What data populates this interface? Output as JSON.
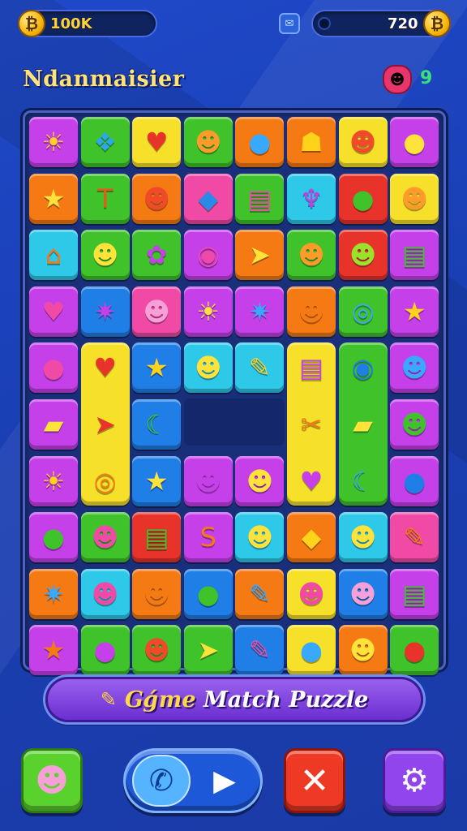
{
  "hud": {
    "coins": "100K",
    "coin_symbol": "₿",
    "score": "720",
    "badge_icon": "chat-badge-icon"
  },
  "player": {
    "name": "Ndanmaisier",
    "avatar_icon": "creature-avatar-icon",
    "level": "9"
  },
  "banner": {
    "first_word": "Gǵme",
    "rest": "Match Puzzle",
    "icon": "pencil-icon"
  },
  "buttons": {
    "face_icon": "pink-creature-icon",
    "call_icon": "phone-icon",
    "play_icon": "play-icon",
    "close_icon": "close-icon",
    "settings_icon": "gear-icon"
  },
  "board": {
    "colors": {
      "purple": "#c640ea",
      "green": "#3fc22a",
      "yellow": "#f7e02a",
      "orange": "#f57a14",
      "blue": "#1f7fe6",
      "cyan": "#2ec8e8",
      "pink": "#f04aa6",
      "red": "#e8332a",
      "lime": "#9be22c"
    },
    "rows": [
      [
        [
          "purple",
          "☀",
          "#ffd21c"
        ],
        [
          "green",
          "❖",
          "#2aa8e8"
        ],
        [
          "yellow",
          "♥",
          "#e8332a"
        ],
        [
          "green",
          "☻",
          "#ff9b2a"
        ],
        [
          "orange",
          "●",
          "#39a8ff"
        ],
        [
          "orange",
          "☗",
          "#ffd21c"
        ],
        [
          "yellow",
          "☻",
          "#f04a2a"
        ],
        [
          "purple",
          "●",
          "#ffe23a"
        ]
      ],
      [
        [
          "orange",
          "★",
          "#ffe23a"
        ],
        [
          "green",
          "T",
          "#e85a1a"
        ],
        [
          "orange",
          "☻",
          "#f04a2a"
        ],
        [
          "pink",
          "◆",
          "#2a8ae8"
        ],
        [
          "green",
          "▤",
          "#f04aa6"
        ],
        [
          "cyan",
          "♆",
          "#c640ea"
        ],
        [
          "red",
          "●",
          "#3fc22a"
        ],
        [
          "yellow",
          "☻",
          "#ff9b2a"
        ]
      ],
      [
        [
          "cyan",
          "⌂",
          "#f57a14"
        ],
        [
          "green",
          "☻",
          "#ffe23a"
        ],
        [
          "green",
          "✿",
          "#c640ea"
        ],
        [
          "purple",
          "◉",
          "#f04aa6"
        ],
        [
          "orange",
          "➤",
          "#ffe23a"
        ],
        [
          "green",
          "☻",
          "#ff9b2a"
        ],
        [
          "red",
          "☻",
          "#9be22c"
        ],
        [
          "purple",
          "▤",
          "#3fc22a"
        ]
      ],
      [
        [
          "purple",
          "♥",
          "#f04aa6"
        ],
        [
          "blue",
          "✷",
          "#c640ea"
        ],
        [
          "pink",
          "☻",
          "#f7a0d8"
        ],
        [
          "purple",
          "☀",
          "#ffe23a"
        ],
        [
          "purple",
          "✷",
          "#39a8ff"
        ],
        [
          "orange",
          "☻",
          "#f57a14"
        ],
        [
          "green",
          "◎",
          "#39a8ff"
        ],
        [
          "purple",
          "★",
          "#ffd21c"
        ]
      ],
      [
        [
          "purple",
          "●",
          "#f04aa6"
        ],
        null,
        [
          "blue",
          "★",
          "#ffd21c"
        ],
        [
          "cyan",
          "☻",
          "#ffe23a"
        ],
        [
          "cyan",
          "✎",
          "#ffd21c"
        ],
        null,
        null,
        [
          "purple",
          "☻",
          "#39a8ff"
        ]
      ],
      [
        [
          "purple",
          "▰",
          "#ffe23a"
        ],
        null,
        [
          "blue",
          "☾",
          "#3fc22a"
        ],
        null,
        null,
        null,
        null,
        [
          "purple",
          "☻",
          "#3fc22a"
        ]
      ],
      [
        [
          "purple",
          "☀",
          "#ffd21c"
        ],
        null,
        [
          "blue",
          "★",
          "#ffe23a"
        ],
        [
          "purple",
          "☻",
          "#c640ea"
        ],
        [
          "purple",
          "☻",
          "#ffe23a"
        ],
        null,
        null,
        [
          "purple",
          "●",
          "#1f7fe6"
        ]
      ],
      [
        [
          "purple",
          "●",
          "#3fc22a"
        ],
        [
          "green",
          "☻",
          "#f04aa6"
        ],
        [
          "red",
          "▤",
          "#3fc22a"
        ],
        [
          "purple",
          "S",
          "#f57a14"
        ],
        [
          "cyan",
          "☻",
          "#ffe23a"
        ],
        [
          "orange",
          "◆",
          "#ffd21c"
        ],
        [
          "cyan",
          "☻",
          "#ffe23a"
        ],
        [
          "pink",
          "✎",
          "#f57a14"
        ]
      ],
      [
        [
          "orange",
          "✷",
          "#39a8ff"
        ],
        [
          "cyan",
          "☻",
          "#f04aa6"
        ],
        [
          "orange",
          "☻",
          "#f57a14"
        ],
        [
          "blue",
          "●",
          "#3fc22a"
        ],
        [
          "orange",
          "✎",
          "#39a8ff"
        ],
        [
          "yellow",
          "☻",
          "#f04aa6"
        ],
        [
          "blue",
          "☻",
          "#f7a0d8"
        ],
        [
          "purple",
          "▤",
          "#3fc22a"
        ]
      ],
      [
        [
          "purple",
          "★",
          "#f57a14"
        ],
        [
          "green",
          "●",
          "#c640ea"
        ],
        [
          "green",
          "☻",
          "#f04a2a"
        ],
        [
          "green",
          "➤",
          "#ffe23a"
        ],
        [
          "blue",
          "✎",
          "#f04aa6"
        ],
        [
          "yellow",
          "●",
          "#39a8ff"
        ],
        [
          "orange",
          "☻",
          "#ffe23a"
        ],
        [
          "green",
          "●",
          "#e8332a"
        ]
      ]
    ],
    "tall_tiles": [
      {
        "col": 1,
        "row": 4,
        "span": 3,
        "color": "yellow",
        "glyphs": [
          [
            "♥",
            "#e8332a"
          ],
          [
            "➤",
            "#e8332a"
          ],
          [
            "◎",
            "#f57a14"
          ]
        ]
      },
      {
        "col": 5,
        "row": 4,
        "span": 3,
        "color": "yellow",
        "glyphs": [
          [
            "▤",
            "#c640ea"
          ],
          [
            "✂",
            "#f57a14"
          ],
          [
            "♥",
            "#c640ea"
          ]
        ]
      },
      {
        "col": 6,
        "row": 4,
        "span": 3,
        "color": "green",
        "glyphs": [
          [
            "◉",
            "#1f7fe6"
          ],
          [
            "▰",
            "#ffe23a"
          ],
          [
            "☾",
            "#39a8ff"
          ]
        ]
      }
    ]
  }
}
